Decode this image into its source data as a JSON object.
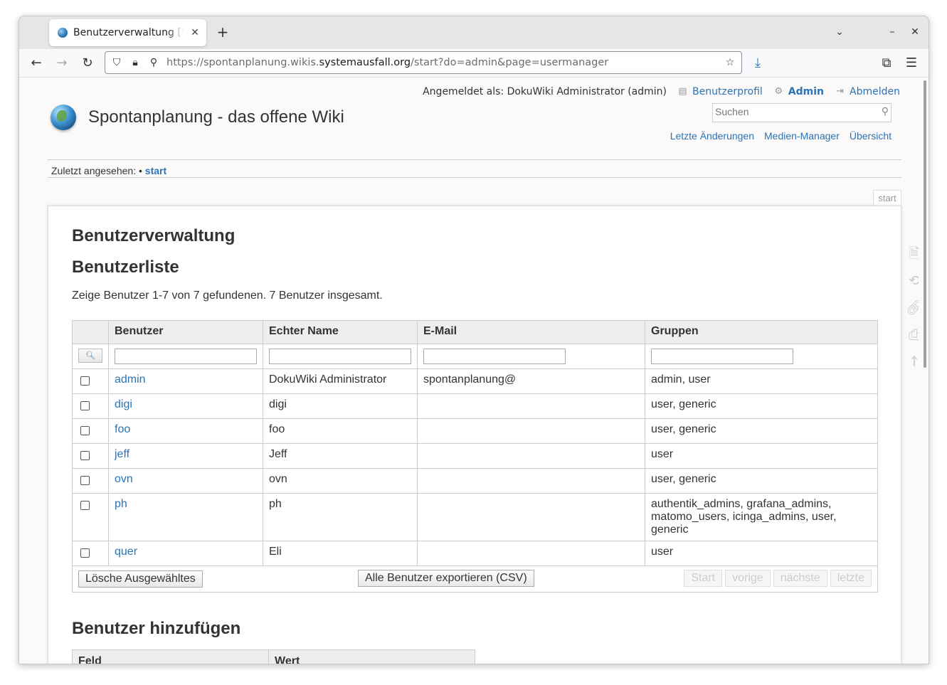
{
  "browser": {
    "tab_title": "Benutzerverwaltung [Spontanplanung - das offene Wiki]",
    "url_prefix": "https://spontanplanung.wikis.",
    "url_host": "systemausfall.org",
    "url_path": "/start?do=admin&page=usermanager"
  },
  "header": {
    "logged_in": "Angemeldet als: DokuWiki Administrator (admin)",
    "profile": "Benutzerprofil",
    "admin": "Admin",
    "logout": "Abmelden",
    "site_title": "Spontanplanung - das offene Wiki",
    "search_placeholder": "Suchen",
    "tools": [
      "Letzte Änderungen",
      "Medien-Manager",
      "Übersicht"
    ]
  },
  "breadcrumb": {
    "label": "Zuletzt angesehen:",
    "item": "start"
  },
  "page_tab": "start",
  "content": {
    "title": "Benutzerverwaltung",
    "list_title": "Benutzerliste",
    "summary": "Zeige Benutzer 1-7 von 7 gefundenen. 7 Benutzer insgesamt.",
    "columns": [
      "Benutzer",
      "Echter Name",
      "E-Mail",
      "Gruppen"
    ],
    "users": [
      {
        "user": "admin",
        "name": "DokuWiki Administrator",
        "email": "spontanplanung@",
        "groups": "admin, user"
      },
      {
        "user": "digi",
        "name": "digi",
        "email": "",
        "groups": "user, generic"
      },
      {
        "user": "foo",
        "name": "foo",
        "email": "",
        "groups": "user, generic"
      },
      {
        "user": "jeff",
        "name": "Jeff",
        "email": "",
        "groups": "user"
      },
      {
        "user": "ovn",
        "name": "ovn",
        "email": "",
        "groups": "user, generic"
      },
      {
        "user": "ph",
        "name": "ph",
        "email": "",
        "groups": "authentik_admins, grafana_admins, matomo_users, icinga_admins, user, generic"
      },
      {
        "user": "quer",
        "name": "Eli",
        "email": "",
        "groups": "user"
      }
    ],
    "delete_btn": "Lösche Ausgewähltes",
    "export_btn": "Alle Benutzer exportieren (CSV)",
    "pager": [
      "Start",
      "vorige",
      "nächste",
      "letzte"
    ],
    "add_title": "Benutzer hinzufügen",
    "add_columns": [
      "Feld",
      "Wert"
    ]
  },
  "icons": [
    "shield-icon",
    "lock-icon",
    "permissions-icon",
    "bookmark-star-icon",
    "download-icon",
    "extensions-icon",
    "menu-icon"
  ]
}
